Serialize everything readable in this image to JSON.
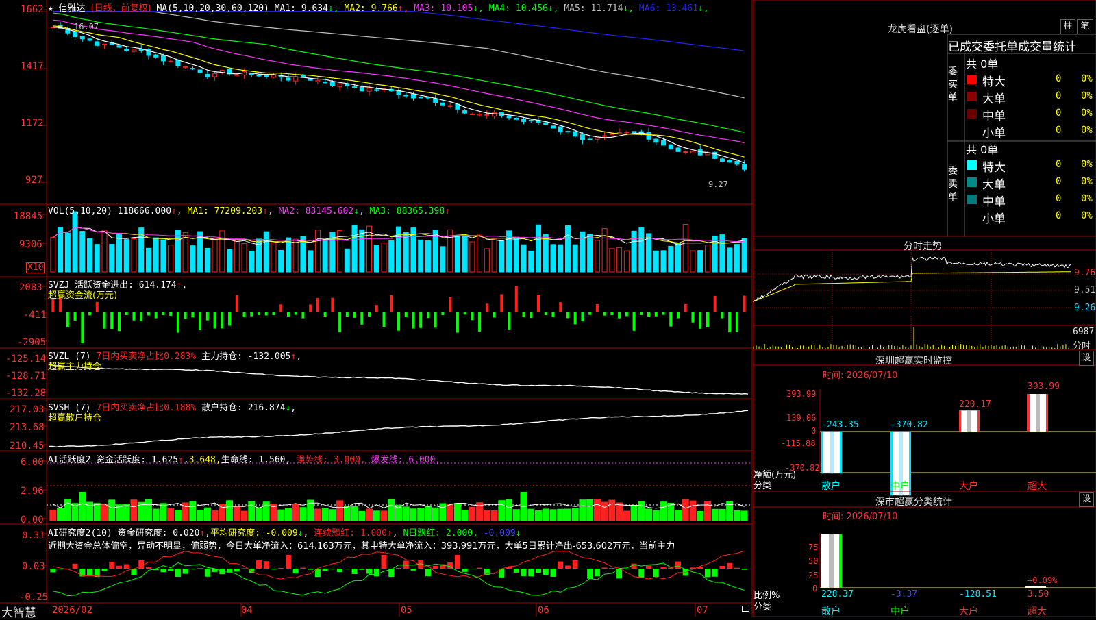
{
  "stock": {
    "star": "★",
    "name": "信雅达",
    "period": "(日线，前复权)"
  },
  "colors": {
    "up": "#ff2020",
    "down": "#00e5ff",
    "grid": "#b00000",
    "white": "#ffffff",
    "yellow": "#ffff00",
    "magenta": "#ff33ff",
    "green": "#00ff00",
    "gray": "#c0c0c0",
    "blue": "#2222ff"
  },
  "price_panel": {
    "ma_header": "MA(5,10,20,30,60,120)",
    "ma_values": [
      {
        "label": "MA1: 9.634",
        "arrow": "↓",
        "color": "#ffffff"
      },
      {
        "label": "MA2: 9.766",
        "arrow": "↑",
        "color": "#ffff00"
      },
      {
        "label": "MA3: 10.105",
        "arrow": "↓",
        "color": "#ff33ff"
      },
      {
        "label": "MA4: 10.456",
        "arrow": "↓",
        "color": "#00ff00"
      },
      {
        "label": "MA5: 11.714",
        "arrow": "↓",
        "color": "#c0c0c0"
      },
      {
        "label": "MA6: 13.461",
        "arrow": "↓",
        "color": "#2222ff"
      }
    ],
    "y_ticks": [
      "1662",
      "1417",
      "1172",
      "927"
    ],
    "high_label": "16.07",
    "low_label": "9.27"
  },
  "vol_panel": {
    "header": "VOL(5,10,20)",
    "value": "118666.000",
    "ma1": "MA1: 77209.203",
    "ma2": "MA2: 83145.602",
    "ma3": "MA3: 88365.398",
    "y_ticks": [
      "18845",
      "9306"
    ],
    "unit": "X10"
  },
  "svzj_panel": {
    "header": "SVZJ  活跃资金进出: 614.174",
    "sub": "超赢资金流(万元)",
    "y_ticks": [
      "2083",
      "-411",
      "-2905"
    ]
  },
  "svzl_panel": {
    "header": "SVZL (7)",
    "red": "7日内买卖净占比0.283%",
    "rest": "主力持仓: -132.005",
    "sub": "超赢主力持仓",
    "y_ticks": [
      "-125.14",
      "-128.71",
      "-132.28"
    ]
  },
  "svsh_panel": {
    "header": "SVSH (7)",
    "red": "7日内买卖净占比0.188%",
    "rest": "散户持仓: 216.874",
    "sub": "超赢散户持仓",
    "y_ticks": [
      "217.03",
      "213.68",
      "210.45"
    ]
  },
  "ai_act_panel": {
    "header": "AI活跃度2 资金活跃度: 1.625",
    "v2": "3.648,",
    "life": "生命线: 1.560,",
    "strong": "强势线: 3.000,",
    "burst": "爆发线: 6.000,",
    "y_ticks": [
      "6.00",
      "2.96",
      "0.00"
    ]
  },
  "ai_res_panel": {
    "header": "AI研究度2(10) 资金研究度: 0.020",
    "avg": "平均研究度: -0.009",
    "cont": "连续飘红: 1.000",
    "nday": "N日飘红: 2.000,",
    "last": "-0.009",
    "desc": "近期大资金总体偏空，异动不明显，偏弱势，今日大单净流入：614.163万元，其中特大单净流入：393.991万元，大单5日累计净出-653.602万元，当前主力",
    "y_ticks": [
      "0.31",
      "0.03",
      "-0.25"
    ]
  },
  "x_axis": {
    "labels": [
      "2026/02",
      "04",
      "05",
      "06",
      "07"
    ],
    "brand": "大智慧"
  },
  "right": {
    "title": "龙虎看盘(逐单)",
    "btn_zhu": "柱",
    "btn_bi": "笔",
    "tabs": "已成交委托单成交量统计",
    "buy_label": "委买单",
    "sell_label": "委卖单",
    "buy_total": "共 0单",
    "sell_total": "共 0单",
    "buy_rows": [
      {
        "name": "特大",
        "v": "0",
        "p": "0%",
        "c": "#ff0000"
      },
      {
        "name": "大单",
        "v": "0",
        "p": "0%",
        "c": "#8b0000"
      },
      {
        "name": "中单",
        "v": "0",
        "p": "0%",
        "c": "#6b0000"
      },
      {
        "name": "小单",
        "v": "0",
        "p": "0%",
        "c": ""
      }
    ],
    "sell_rows": [
      {
        "name": "特大",
        "v": "0",
        "p": "0%",
        "c": "#00ffff"
      },
      {
        "name": "大单",
        "v": "0",
        "p": "0%",
        "c": "#008b8b"
      },
      {
        "name": "中单",
        "v": "0",
        "p": "0%",
        "c": "#007a7a"
      },
      {
        "name": "小单",
        "v": "0",
        "p": "0%",
        "c": ""
      }
    ],
    "intraday_title": "分时走势",
    "intraday_ticks": [
      "9.76",
      "9.51",
      "9.26"
    ],
    "intraday_vol": "6987",
    "intraday_unit": "分时",
    "monitor_title": "深圳超赢实时监控",
    "monitor_btn": "设",
    "monitor_time": "时间: 2026/07/10",
    "monitor_ticks": [
      "393.99",
      "139.06",
      "0",
      "-115.88",
      "-370.82"
    ],
    "monitor_unit": "净额(万元)",
    "monitor_cat": "分类",
    "monitor_bars": [
      {
        "label": "散户",
        "value": -243.35,
        "text": "-243.35"
      },
      {
        "label": "中户",
        "value": -370.82,
        "text": "-370.82"
      },
      {
        "label": "大户",
        "value": 220.17,
        "text": "220.17"
      },
      {
        "label": "超大",
        "value": 393.99,
        "text": "393.99"
      }
    ],
    "stat_title": "深市超赢分类统计",
    "stat_btn": "设",
    "stat_time": "时间: 2026/07/10",
    "stat_ticks": [
      "75",
      "50",
      "25",
      "0"
    ],
    "stat_unit": "比例%",
    "stat_cat": "分类",
    "stat_pct": "+0.09%",
    "stat_bars": [
      {
        "label": "散户",
        "value": 228.37,
        "text": "228.37",
        "pct": 100
      },
      {
        "label": "中户",
        "value": -3.37,
        "text": "-3.37",
        "pct": 0
      },
      {
        "label": "大户",
        "value": -128.51,
        "text": "-128.51",
        "pct": 0
      },
      {
        "label": "超大",
        "value": 3.5,
        "text": "3.50",
        "pct": 1
      }
    ]
  }
}
